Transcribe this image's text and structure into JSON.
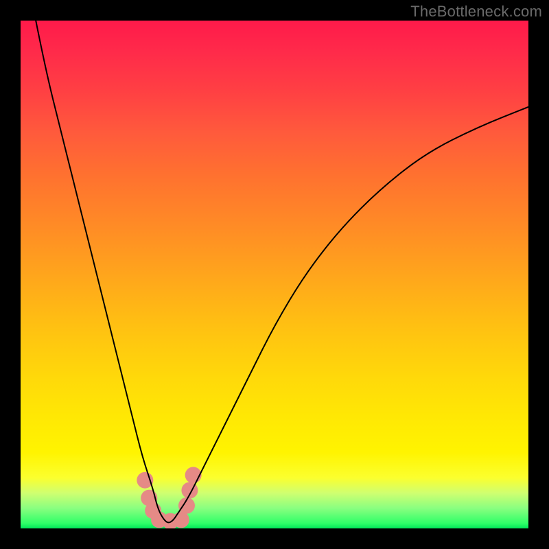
{
  "watermark": "TheBottleneck.com",
  "chart_data": {
    "type": "line",
    "title": "",
    "xlabel": "",
    "ylabel": "",
    "xlim": [
      0,
      100
    ],
    "ylim": [
      0,
      100
    ],
    "background_gradient": {
      "stops": [
        {
          "pct": 0,
          "color": "#ff1a4a"
        },
        {
          "pct": 30,
          "color": "#ff7030"
        },
        {
          "pct": 60,
          "color": "#ffc012"
        },
        {
          "pct": 85,
          "color": "#fff400"
        },
        {
          "pct": 96,
          "color": "#8aff80"
        },
        {
          "pct": 100,
          "color": "#00e658"
        }
      ]
    },
    "series": [
      {
        "name": "bottleneck-curve",
        "color": "#000000",
        "stroke_width": 2,
        "x": [
          3,
          5,
          8,
          11,
          14,
          17,
          20,
          22,
          24,
          26,
          27,
          28,
          29,
          30,
          31,
          33,
          36,
          40,
          45,
          50,
          56,
          63,
          71,
          80,
          90,
          100
        ],
        "y": [
          100,
          90,
          78,
          66,
          54,
          42,
          30,
          22,
          14,
          8,
          4,
          2,
          1,
          1.5,
          3,
          6,
          12,
          20,
          30,
          40,
          50,
          59,
          67,
          74,
          79,
          83
        ]
      }
    ],
    "markers": [
      {
        "name": "dot-left-1",
        "x": 24.5,
        "y": 9.5,
        "color": "#e58a86",
        "r": 12
      },
      {
        "name": "dot-left-2",
        "x": 25.3,
        "y": 6.0,
        "color": "#e58a86",
        "r": 12
      },
      {
        "name": "dot-left-3",
        "x": 26.1,
        "y": 3.5,
        "color": "#e58a86",
        "r": 12
      },
      {
        "name": "dot-bottom-1",
        "x": 27.3,
        "y": 1.7,
        "color": "#e58a86",
        "r": 12
      },
      {
        "name": "dot-bottom-2",
        "x": 29.5,
        "y": 1.4,
        "color": "#e58a86",
        "r": 12
      },
      {
        "name": "dot-bottom-3",
        "x": 31.6,
        "y": 1.7,
        "color": "#e58a86",
        "r": 12
      },
      {
        "name": "dot-right-1",
        "x": 32.7,
        "y": 4.5,
        "color": "#e58a86",
        "r": 12
      },
      {
        "name": "dot-right-2",
        "x": 33.3,
        "y": 7.5,
        "color": "#e58a86",
        "r": 12
      },
      {
        "name": "dot-right-3",
        "x": 34.0,
        "y": 10.5,
        "color": "#e58a86",
        "r": 12
      }
    ]
  }
}
